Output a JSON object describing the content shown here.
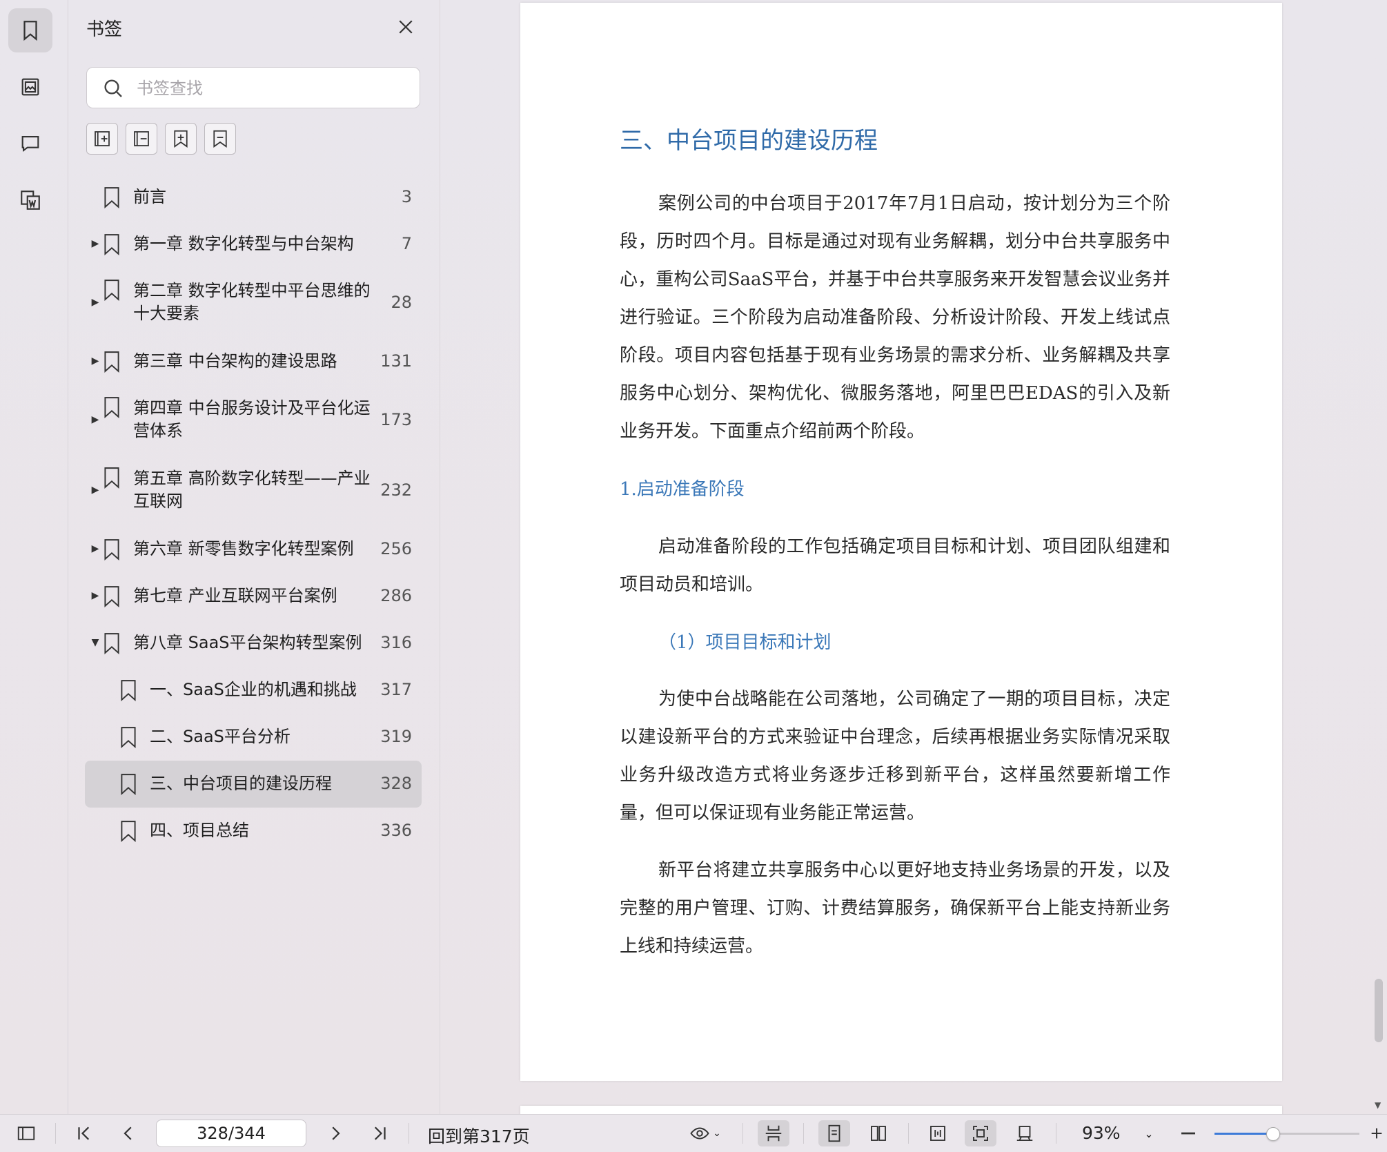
{
  "panel": {
    "title": "书签",
    "search_placeholder": "书签查找"
  },
  "bookmarks": [
    {
      "title": "前言",
      "page": "3",
      "level": 0,
      "expand": "none"
    },
    {
      "title": "第一章 数字化转型与中台架构",
      "page": "7",
      "level": 0,
      "expand": "collapsed"
    },
    {
      "title": "第二章 数字化转型中平台思维的\n十大要素",
      "page": "28",
      "level": 0,
      "expand": "collapsed"
    },
    {
      "title": "第三章 中台架构的建设思路",
      "page": "131",
      "level": 0,
      "expand": "collapsed"
    },
    {
      "title": "第四章 中台服务设计及平台化运\n营体系",
      "page": "173",
      "level": 0,
      "expand": "collapsed"
    },
    {
      "title": "第五章 高阶数字化转型——产业\n互联网",
      "page": "232",
      "level": 0,
      "expand": "collapsed"
    },
    {
      "title": "第六章 新零售数字化转型案例",
      "page": "256",
      "level": 0,
      "expand": "collapsed"
    },
    {
      "title": "第七章 产业互联网平台案例",
      "page": "286",
      "level": 0,
      "expand": "collapsed"
    },
    {
      "title": "第八章 SaaS平台架构转型案例",
      "page": "316",
      "level": 0,
      "expand": "expanded"
    },
    {
      "title": "一、SaaS企业的机遇和挑战",
      "page": "317",
      "level": 1,
      "expand": "none"
    },
    {
      "title": "二、SaaS平台分析",
      "page": "319",
      "level": 1,
      "expand": "none"
    },
    {
      "title": "三、中台项目的建设历程",
      "page": "328",
      "level": 1,
      "expand": "none",
      "selected": true
    },
    {
      "title": "四、项目总结",
      "page": "336",
      "level": 1,
      "expand": "none"
    }
  ],
  "document": {
    "heading": "三、中台项目的建设历程",
    "para1": "案例公司的中台项目于2017年7月1日启动，按计划分为三个阶段，历时四个月。目标是通过对现有业务解耦，划分中台共享服务中心，重构公司SaaS平台，并基于中台共享服务来开发智慧会议业务并进行验证。三个阶段为启动准备阶段、分析设计阶段、开发上线试点阶段。项目内容包括基于现有业务场景的需求分析、业务解耦及共享服务中心划分、架构优化、微服务落地，阿里巴巴EDAS的引入及新业务开发。下面重点介绍前两个阶段。",
    "subheading1": "1.启动准备阶段",
    "para2": "启动准备阶段的工作包括确定项目目标和计划、项目团队组建和项目动员和培训。",
    "subheading2": "（1）项目目标和计划",
    "para3": "为使中台战略能在公司落地，公司确定了一期的项目目标，决定以建设新平台的方式来验证中台理念，后续再根据业务实际情况采取业务升级改造方式将业务逐步迁移到新平台，这样虽然要新增工作量，但可以保证现有业务能正常运营。",
    "para4": "新平台将建立共享服务中心以更好地支持业务场景的开发，以及完整的用户管理、订购、计费结算服务，确保新平台上能支持新业务上线和持续运营。"
  },
  "bottombar": {
    "page_indicator": "328/344",
    "go_back": "回到第317页",
    "zoom": "93%",
    "zoom_fraction": 0.4
  },
  "colors": {
    "heading_blue": "#2f6aa8",
    "accent_blue": "#3d7bd8"
  }
}
